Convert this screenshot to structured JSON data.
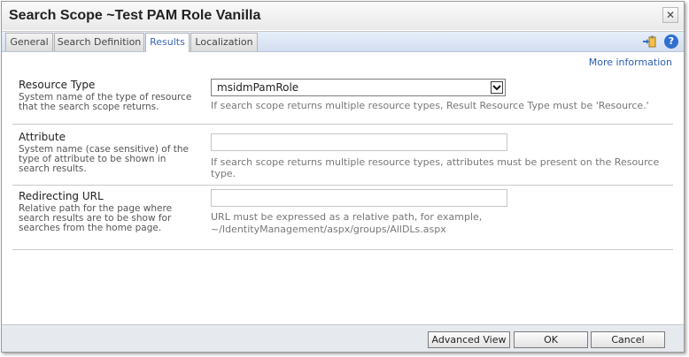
{
  "window": {
    "title": "Search Scope ~Test PAM Role Vanilla",
    "close_glyph": "✕"
  },
  "tabs": [
    {
      "label": "General"
    },
    {
      "label": "Search Definition"
    },
    {
      "label": "Results"
    },
    {
      "label": "Localization"
    }
  ],
  "active_tab": "Results",
  "toolbar": {
    "help_glyph": "?"
  },
  "more_info": "More information",
  "fields": {
    "resource_type": {
      "label": "Resource Type",
      "description": "System name of the type of resource that the search scope returns.",
      "value": "msidmPamRole",
      "hint": "If search scope returns multiple resource types, Result Resource Type must be 'Resource.'"
    },
    "attribute": {
      "label": "Attribute",
      "description": "System name (case sensitive) of the type of attribute to be shown in search results.",
      "value": "",
      "hint": "If search scope returns multiple resource types, attributes must be present on the Resource type."
    },
    "redirecting_url": {
      "label": "Redirecting URL",
      "description": "Relative path for the page where search results are to be show for searches from the home page.",
      "value": "",
      "hint_line1": "URL must be expressed as a relative path, for example,",
      "hint_line2": "~/IdentityManagement/aspx/groups/AllDLs.aspx"
    }
  },
  "buttons": {
    "advanced_view": "Advanced View",
    "ok": "OK",
    "cancel": "Cancel"
  }
}
